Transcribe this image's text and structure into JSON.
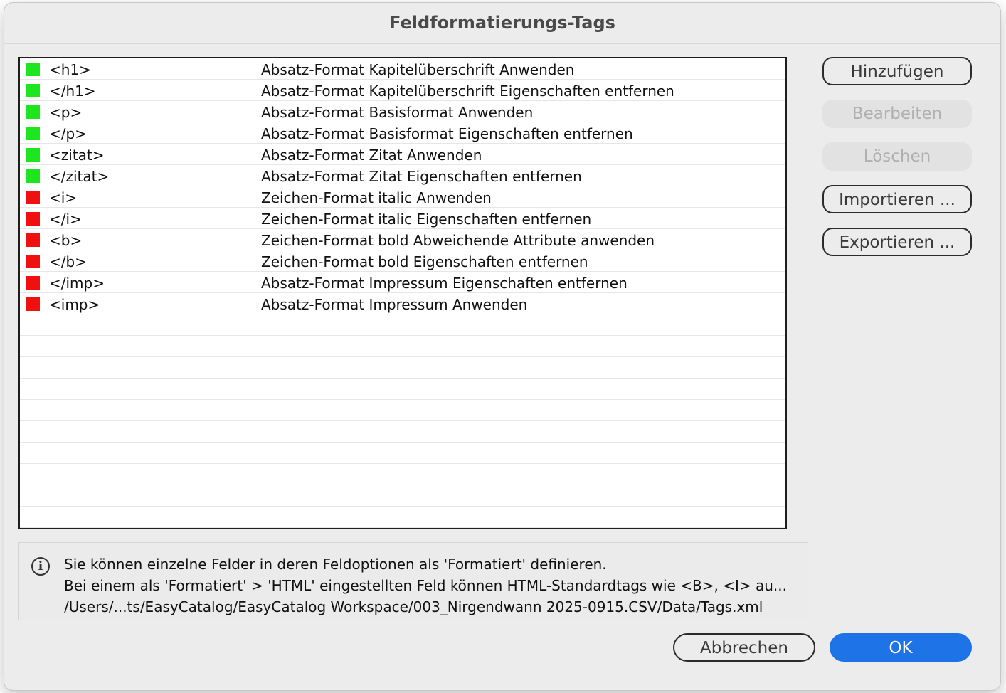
{
  "dialog": {
    "title": "Feldformatierungs-Tags"
  },
  "colors": {
    "paragraph_style": "#1ee61e",
    "character_style": "#f01010",
    "primary_button": "#1e74e6"
  },
  "tags": [
    {
      "tag": "<h1>",
      "description": "Absatz-Format Kapitelüberschrift Anwenden",
      "kind": "paragraph"
    },
    {
      "tag": "</h1>",
      "description": "Absatz-Format Kapitelüberschrift Eigenschaften entfernen",
      "kind": "paragraph"
    },
    {
      "tag": "<p>",
      "description": "Absatz-Format Basisformat Anwenden",
      "kind": "paragraph"
    },
    {
      "tag": "</p>",
      "description": "Absatz-Format Basisformat Eigenschaften entfernen",
      "kind": "paragraph"
    },
    {
      "tag": "<zitat>",
      "description": "Absatz-Format Zitat Anwenden",
      "kind": "paragraph"
    },
    {
      "tag": "</zitat>",
      "description": "Absatz-Format Zitat Eigenschaften entfernen",
      "kind": "paragraph"
    },
    {
      "tag": "<i>",
      "description": "Zeichen-Format italic Anwenden",
      "kind": "character"
    },
    {
      "tag": "</i>",
      "description": "Zeichen-Format italic Eigenschaften entfernen",
      "kind": "character"
    },
    {
      "tag": "<b>",
      "description": "Zeichen-Format bold Abweichende Attribute anwenden",
      "kind": "character"
    },
    {
      "tag": "</b>",
      "description": "Zeichen-Format bold Eigenschaften entfernen",
      "kind": "character"
    },
    {
      "tag": "</imp>",
      "description": "Absatz-Format Impressum Eigenschaften entfernen",
      "kind": "character"
    },
    {
      "tag": "<imp>",
      "description": "Absatz-Format Impressum Anwenden",
      "kind": "character"
    }
  ],
  "side_buttons": {
    "add": "Hinzufügen",
    "edit": "Bearbeiten",
    "delete": "Löschen",
    "import": "Importieren ...",
    "export": "Exportieren ..."
  },
  "info": {
    "icon": "info-icon",
    "line1": "Sie können einzelne Felder in deren Feldoptionen als 'Formatiert' definieren.",
    "line2": "Bei einem als 'Formatiert' > 'HTML' eingestellten Feld können HTML-Standardtags wie <B>, <I> au...",
    "line3": "/Users/...ts/EasyCatalog/EasyCatalog Workspace/003_Nirgendwann 2025-0915.CSV/Data/Tags.xml"
  },
  "footer": {
    "cancel": "Abbrechen",
    "ok": "OK"
  }
}
